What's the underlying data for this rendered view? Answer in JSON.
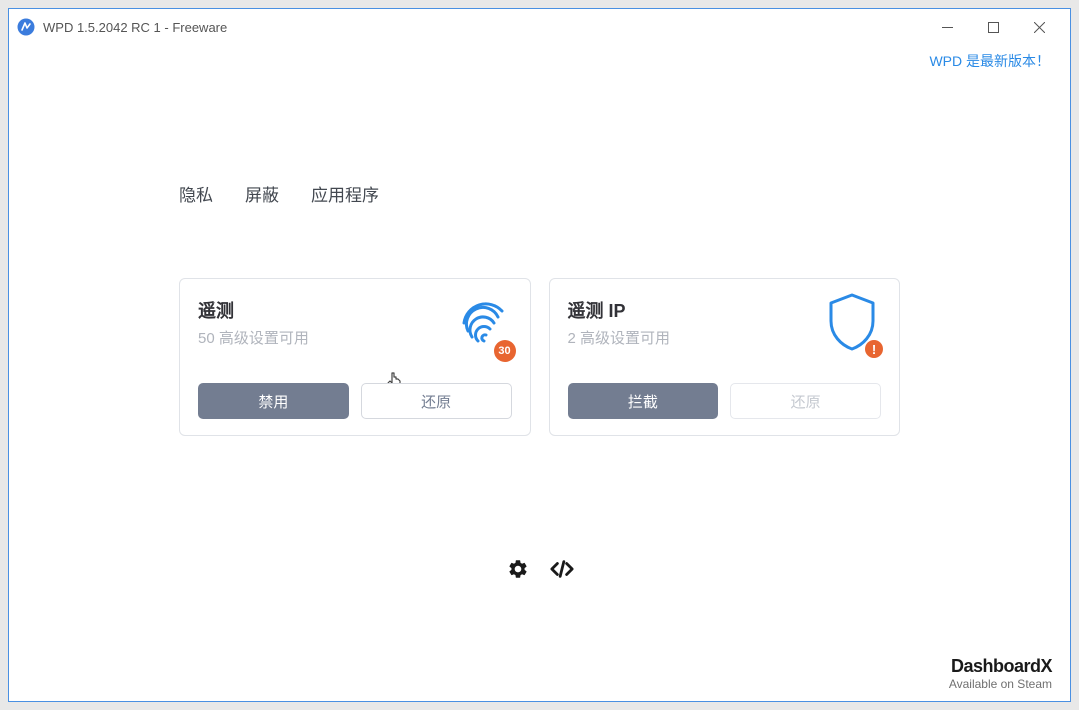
{
  "window": {
    "title": "WPD 1.5.2042 RC 1 - Freeware"
  },
  "updateBanner": "WPD 是最新版本！",
  "tabs": [
    {
      "label": "隐私"
    },
    {
      "label": "屏蔽"
    },
    {
      "label": "应用程序"
    }
  ],
  "cards": [
    {
      "title": "遥测",
      "subtitle": "50 高级设置可用",
      "badge": "30",
      "icon": "fingerprint-icon",
      "primary": "禁用",
      "secondary": "还原",
      "secondaryDisabled": false
    },
    {
      "title": "遥测 IP",
      "subtitle": "2 高级设置可用",
      "badge": "!",
      "icon": "shield-icon",
      "primary": "拦截",
      "secondary": "还原",
      "secondaryDisabled": true
    }
  ],
  "footer": {
    "brand": "DashboardX",
    "sub": "Available on Steam"
  },
  "colors": {
    "accent": "#2a8ae6",
    "warn": "#e86530",
    "primaryBtn": "#737d91"
  }
}
